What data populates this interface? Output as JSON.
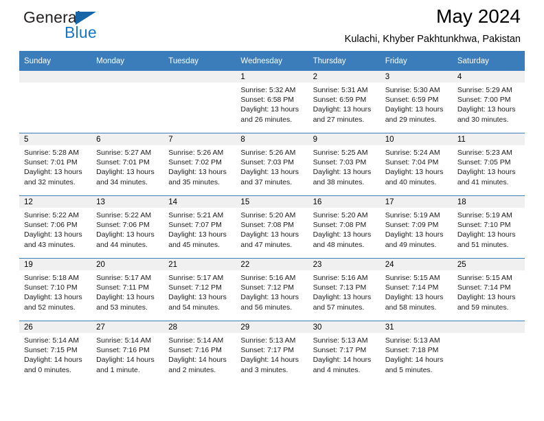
{
  "logo": {
    "word_one": "General",
    "word_two": "Blue",
    "triangle_color": "#1565a8",
    "blue_color": "#1777c4"
  },
  "header": {
    "title": "May 2024",
    "subtitle": "Kulachi, Khyber Pakhtunkhwa, Pakistan"
  },
  "theme": {
    "header_blue": "#3a7dba",
    "daynum_band": "#f0f0f0"
  },
  "calendar": {
    "weekdays": [
      "Sunday",
      "Monday",
      "Tuesday",
      "Wednesday",
      "Thursday",
      "Friday",
      "Saturday"
    ],
    "weeks": [
      [
        {
          "day": "",
          "sunrise": "",
          "sunset": "",
          "daylight": ""
        },
        {
          "day": "",
          "sunrise": "",
          "sunset": "",
          "daylight": ""
        },
        {
          "day": "",
          "sunrise": "",
          "sunset": "",
          "daylight": ""
        },
        {
          "day": "1",
          "sunrise": "Sunrise: 5:32 AM",
          "sunset": "Sunset: 6:58 PM",
          "daylight": "Daylight: 13 hours and 26 minutes."
        },
        {
          "day": "2",
          "sunrise": "Sunrise: 5:31 AM",
          "sunset": "Sunset: 6:59 PM",
          "daylight": "Daylight: 13 hours and 27 minutes."
        },
        {
          "day": "3",
          "sunrise": "Sunrise: 5:30 AM",
          "sunset": "Sunset: 6:59 PM",
          "daylight": "Daylight: 13 hours and 29 minutes."
        },
        {
          "day": "4",
          "sunrise": "Sunrise: 5:29 AM",
          "sunset": "Sunset: 7:00 PM",
          "daylight": "Daylight: 13 hours and 30 minutes."
        }
      ],
      [
        {
          "day": "5",
          "sunrise": "Sunrise: 5:28 AM",
          "sunset": "Sunset: 7:01 PM",
          "daylight": "Daylight: 13 hours and 32 minutes."
        },
        {
          "day": "6",
          "sunrise": "Sunrise: 5:27 AM",
          "sunset": "Sunset: 7:01 PM",
          "daylight": "Daylight: 13 hours and 34 minutes."
        },
        {
          "day": "7",
          "sunrise": "Sunrise: 5:26 AM",
          "sunset": "Sunset: 7:02 PM",
          "daylight": "Daylight: 13 hours and 35 minutes."
        },
        {
          "day": "8",
          "sunrise": "Sunrise: 5:26 AM",
          "sunset": "Sunset: 7:03 PM",
          "daylight": "Daylight: 13 hours and 37 minutes."
        },
        {
          "day": "9",
          "sunrise": "Sunrise: 5:25 AM",
          "sunset": "Sunset: 7:03 PM",
          "daylight": "Daylight: 13 hours and 38 minutes."
        },
        {
          "day": "10",
          "sunrise": "Sunrise: 5:24 AM",
          "sunset": "Sunset: 7:04 PM",
          "daylight": "Daylight: 13 hours and 40 minutes."
        },
        {
          "day": "11",
          "sunrise": "Sunrise: 5:23 AM",
          "sunset": "Sunset: 7:05 PM",
          "daylight": "Daylight: 13 hours and 41 minutes."
        }
      ],
      [
        {
          "day": "12",
          "sunrise": "Sunrise: 5:22 AM",
          "sunset": "Sunset: 7:06 PM",
          "daylight": "Daylight: 13 hours and 43 minutes."
        },
        {
          "day": "13",
          "sunrise": "Sunrise: 5:22 AM",
          "sunset": "Sunset: 7:06 PM",
          "daylight": "Daylight: 13 hours and 44 minutes."
        },
        {
          "day": "14",
          "sunrise": "Sunrise: 5:21 AM",
          "sunset": "Sunset: 7:07 PM",
          "daylight": "Daylight: 13 hours and 45 minutes."
        },
        {
          "day": "15",
          "sunrise": "Sunrise: 5:20 AM",
          "sunset": "Sunset: 7:08 PM",
          "daylight": "Daylight: 13 hours and 47 minutes."
        },
        {
          "day": "16",
          "sunrise": "Sunrise: 5:20 AM",
          "sunset": "Sunset: 7:08 PM",
          "daylight": "Daylight: 13 hours and 48 minutes."
        },
        {
          "day": "17",
          "sunrise": "Sunrise: 5:19 AM",
          "sunset": "Sunset: 7:09 PM",
          "daylight": "Daylight: 13 hours and 49 minutes."
        },
        {
          "day": "18",
          "sunrise": "Sunrise: 5:19 AM",
          "sunset": "Sunset: 7:10 PM",
          "daylight": "Daylight: 13 hours and 51 minutes."
        }
      ],
      [
        {
          "day": "19",
          "sunrise": "Sunrise: 5:18 AM",
          "sunset": "Sunset: 7:10 PM",
          "daylight": "Daylight: 13 hours and 52 minutes."
        },
        {
          "day": "20",
          "sunrise": "Sunrise: 5:17 AM",
          "sunset": "Sunset: 7:11 PM",
          "daylight": "Daylight: 13 hours and 53 minutes."
        },
        {
          "day": "21",
          "sunrise": "Sunrise: 5:17 AM",
          "sunset": "Sunset: 7:12 PM",
          "daylight": "Daylight: 13 hours and 54 minutes."
        },
        {
          "day": "22",
          "sunrise": "Sunrise: 5:16 AM",
          "sunset": "Sunset: 7:12 PM",
          "daylight": "Daylight: 13 hours and 56 minutes."
        },
        {
          "day": "23",
          "sunrise": "Sunrise: 5:16 AM",
          "sunset": "Sunset: 7:13 PM",
          "daylight": "Daylight: 13 hours and 57 minutes."
        },
        {
          "day": "24",
          "sunrise": "Sunrise: 5:15 AM",
          "sunset": "Sunset: 7:14 PM",
          "daylight": "Daylight: 13 hours and 58 minutes."
        },
        {
          "day": "25",
          "sunrise": "Sunrise: 5:15 AM",
          "sunset": "Sunset: 7:14 PM",
          "daylight": "Daylight: 13 hours and 59 minutes."
        }
      ],
      [
        {
          "day": "26",
          "sunrise": "Sunrise: 5:14 AM",
          "sunset": "Sunset: 7:15 PM",
          "daylight": "Daylight: 14 hours and 0 minutes."
        },
        {
          "day": "27",
          "sunrise": "Sunrise: 5:14 AM",
          "sunset": "Sunset: 7:16 PM",
          "daylight": "Daylight: 14 hours and 1 minute."
        },
        {
          "day": "28",
          "sunrise": "Sunrise: 5:14 AM",
          "sunset": "Sunset: 7:16 PM",
          "daylight": "Daylight: 14 hours and 2 minutes."
        },
        {
          "day": "29",
          "sunrise": "Sunrise: 5:13 AM",
          "sunset": "Sunset: 7:17 PM",
          "daylight": "Daylight: 14 hours and 3 minutes."
        },
        {
          "day": "30",
          "sunrise": "Sunrise: 5:13 AM",
          "sunset": "Sunset: 7:17 PM",
          "daylight": "Daylight: 14 hours and 4 minutes."
        },
        {
          "day": "31",
          "sunrise": "Sunrise: 5:13 AM",
          "sunset": "Sunset: 7:18 PM",
          "daylight": "Daylight: 14 hours and 5 minutes."
        },
        {
          "day": "",
          "sunrise": "",
          "sunset": "",
          "daylight": ""
        }
      ]
    ]
  }
}
